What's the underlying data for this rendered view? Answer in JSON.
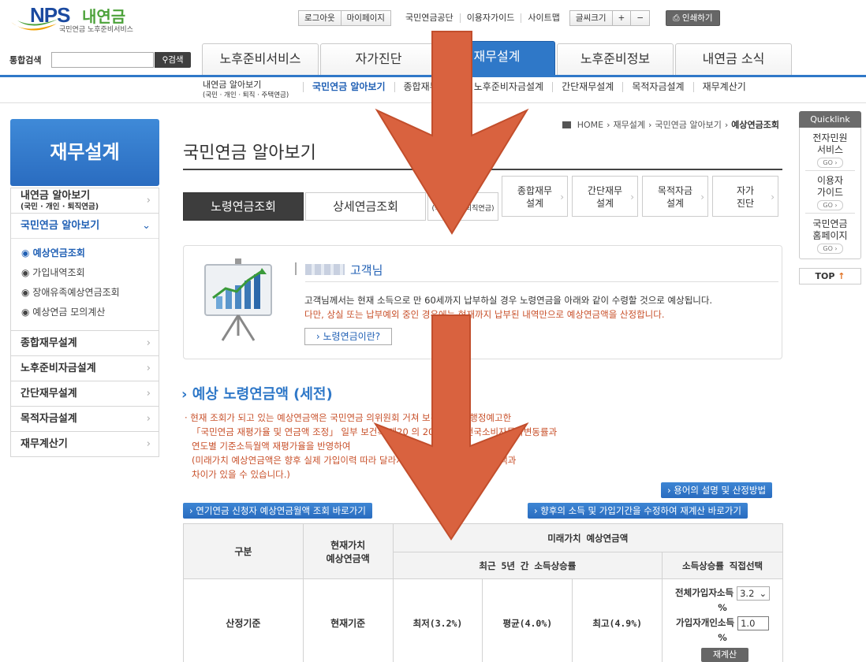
{
  "header": {
    "logo_nps": "NPS",
    "logo_sub": "내연금",
    "logo_tag": "국민연금 노후준비서비스",
    "util_buttons": [
      "로그아웃",
      "마이페이지"
    ],
    "util_links": [
      "국민연금공단",
      "이용자가이드",
      "사이트맵"
    ],
    "font_size_label": "글씨크기",
    "font_plus": "+",
    "font_minus": "−",
    "print_label": "인쇄하기",
    "search_label": "통합검색",
    "search_button": "검색",
    "gnb": [
      "노후준비서비스",
      "자가진단",
      "재무설계",
      "노후준비정보",
      "내연금 소식"
    ],
    "gnb_active_index": 2,
    "accent_color": "#2f78c8"
  },
  "subnav": {
    "first_line1": "내연금 알아보기",
    "first_line2": "(국민 · 개인 · 퇴직 · 주택연금)",
    "items": [
      "국민연금 알아보기",
      "종합재무설계",
      "노후준비자금설계",
      "간단재무설계",
      "목적자금설계",
      "재무계산기"
    ]
  },
  "lnb": {
    "title": "재무설계",
    "item1_line1": "내연금 알아보기",
    "item1_line2": "(국민 · 개인 · 퇴직연금)",
    "item2": "국민연금 알아보기",
    "sub_items": [
      "예상연금조회",
      "가입내역조회",
      "장애유족예상연금조회",
      "예상연금 모의계산"
    ],
    "rest_items": [
      "종합재무설계",
      "노후준비자금설계",
      "간단재무설계",
      "목적자금설계",
      "재무계산기"
    ]
  },
  "breadcrumb": {
    "home": "HOME",
    "path": [
      "재무설계",
      "국민연금 알아보기"
    ],
    "current": "예상연금조회"
  },
  "page_title": "국민연금 알아보기",
  "content_tabs": [
    "노령연금조회",
    "상세연금조회",
    "(국민·개인·퇴직연금)"
  ],
  "service_tabs": [
    {
      "l1": "종합재무",
      "l2": "설계"
    },
    {
      "l1": "간단재무",
      "l2": "설계"
    },
    {
      "l1": "목적자금",
      "l2": "설계"
    },
    {
      "l1": "자가",
      "l2": "진단"
    }
  ],
  "info": {
    "customer": "고객님",
    "desc1": "고객님께서는 현재 소득으로 만 60세까지 납부하실 경우 노령연금을 아래와 같이 수령할 것으로 예상됩니다.",
    "desc2": "다만, 상실 또는 납부예외 중인 경우에는 현재까지 납부된 내역만으로 예상연금액을 산정합니다.",
    "what_button": "노령연금이란?"
  },
  "section": {
    "title": "예상 노령연금액 (세전)",
    "notes": [
      "· 현재 조회가 되고 있는 예상연금액은 국민연금 의위원회 거쳐 보건 부에서 행정예고한",
      "「국민연금 재평가율 및 연금액 조정」 일부 보건복 제20 의 2019년도 전국소비자물가변동률과",
      "연도별 기준소득월액 재평가율을 반영하여",
      "(미래가치 예상연금액은 향후 실제 가입이력 따라 달라지므로 실제로 받게 되는 금액과",
      "차이가 있을 수 있습니다.)"
    ],
    "btn_terms": "용어의 설명 및 산정방법",
    "btn_delay": "연기연금 신청자 예상연금월액 조회 바로가기",
    "btn_recalc": "향후의 소득 및 가입기간을 수정하여 재계산 바로가기"
  },
  "table": {
    "h_category": "구분",
    "h_present_1": "현재가치",
    "h_present_2": "예상연금액",
    "h_future": "미래가치 예상연금액",
    "h_recent": "최근 5년 간 소득상승률",
    "h_direct": "소득상승률 직접선택",
    "row_label": "산정기준",
    "row_present": "현재기준",
    "low": "최저(3.2%)",
    "avg": "평균(4.0%)",
    "high": "최고(4.9%)",
    "all_income_label": "전체가입자소득",
    "all_income_value": "3.2",
    "pct": "%",
    "personal_income_label": "가입자개인소득",
    "personal_income_value": "1.0",
    "recalc": "재계산"
  },
  "quicklink": {
    "title": "Quicklink",
    "items": [
      {
        "l1": "전자민원",
        "l2": "서비스"
      },
      {
        "l1": "이용자",
        "l2": "가이드"
      },
      {
        "l1": "국민연금",
        "l2": "홈페이지"
      }
    ],
    "go": "GO",
    "top": "TOP"
  },
  "overlay_color": "#d9623f"
}
